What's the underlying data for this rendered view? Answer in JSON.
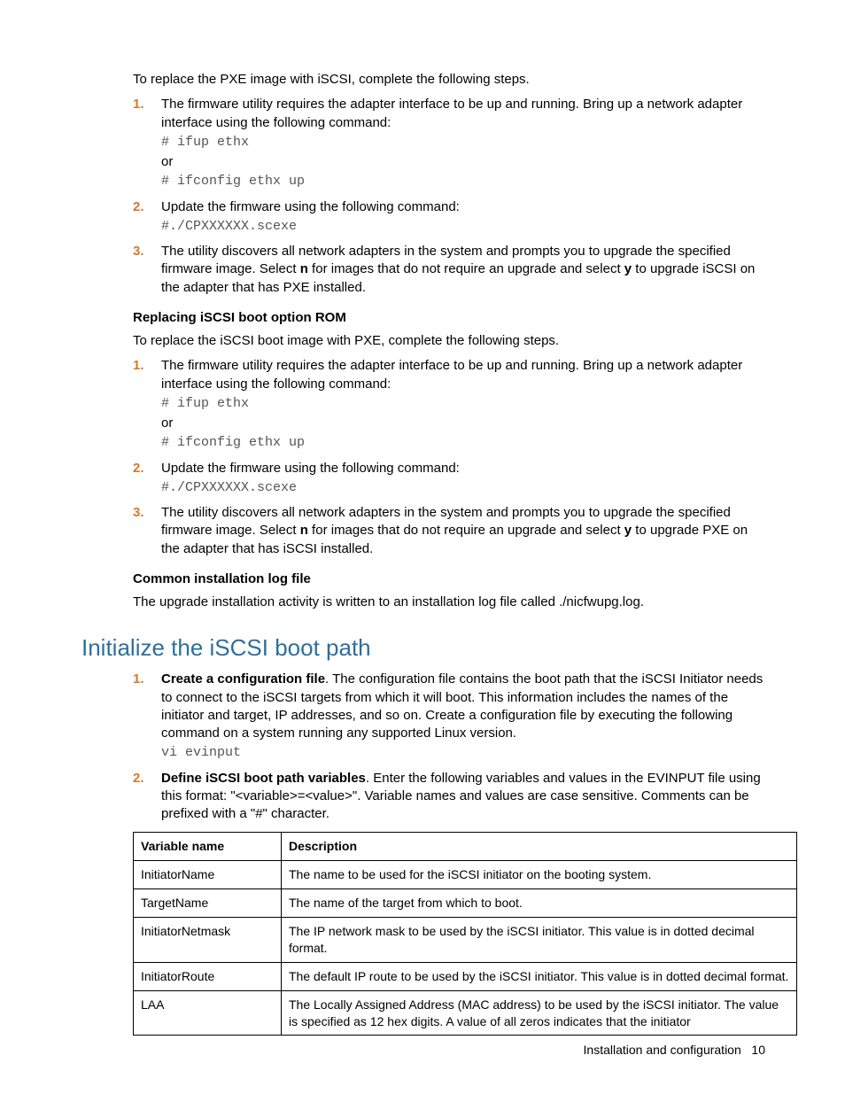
{
  "intro1": "To replace the PXE image with iSCSI, complete the following steps.",
  "stepsA": [
    {
      "num": "1.",
      "text": "The firmware utility requires the adapter interface to be up and running. Bring up a network adapter interface using the following command:",
      "code1": "# ifup ethx",
      "or": "or",
      "code2": "# ifconfig ethx up"
    },
    {
      "num": "2.",
      "text": "Update the firmware using the following command:",
      "code1": "#./CPXXXXXX.scexe"
    },
    {
      "num": "3.",
      "pre": "The utility discovers all network adapters in the system and prompts you to upgrade the specified firmware image. Select ",
      "bold1": "n",
      "mid": " for images that do not require an upgrade and select ",
      "bold2": "y",
      "post": " to upgrade iSCSI on the adapter that has PXE installed."
    }
  ],
  "headingA": "Replacing iSCSI boot option ROM",
  "intro2": "To replace the iSCSI boot image with PXE, complete the following steps.",
  "stepsB": [
    {
      "num": "1.",
      "text": "The firmware utility requires the adapter interface to be up and running. Bring up a network adapter interface using the following command:",
      "code1": "# ifup ethx",
      "or": "or",
      "code2": "# ifconfig ethx up"
    },
    {
      "num": "2.",
      "text": "Update the firmware using the following command:",
      "code1": "#./CPXXXXXX.scexe"
    },
    {
      "num": "3.",
      "pre": "The utility discovers all network adapters in the system and prompts you to upgrade the specified firmware image. Select ",
      "bold1": "n",
      "mid": " for images that do not require an upgrade and select ",
      "bold2": "y",
      "post": " to upgrade PXE on the adapter that has iSCSI installed."
    }
  ],
  "headingB": "Common installation log file",
  "intro3": "The upgrade installation activity is written to an installation log file called ./nicfwupg.log.",
  "sectionHeading": "Initialize the iSCSI boot path",
  "stepsC": [
    {
      "num": "1.",
      "bold": "Create a configuration file",
      "text": ". The configuration file contains the boot path that the iSCSI Initiator needs to connect to the iSCSI targets from which it will boot. This information includes the names of the initiator and target, IP addresses, and so on. Create a configuration file by executing the following command on a system running any supported Linux version.",
      "code1": "vi evinput"
    },
    {
      "num": "2.",
      "bold": "Define iSCSI boot path variables",
      "text": ". Enter the following variables and values in the EVINPUT file using this format: \"<variable>=<value>\".  Variable names and values are case sensitive. Comments can be prefixed with a \"#\" character."
    }
  ],
  "table": {
    "h1": "Variable name",
    "h2": "Description",
    "rows": [
      {
        "name": "InitiatorName",
        "desc": "The name to be used for the iSCSI initiator on the booting system."
      },
      {
        "name": "TargetName",
        "desc": "The name of the target from which to boot."
      },
      {
        "name": "InitiatorNetmask",
        "desc": "The IP network mask to be used by the iSCSI initiator. This value is in dotted decimal format."
      },
      {
        "name": "InitiatorRoute",
        "desc": "The default IP route to be used by the iSCSI initiator. This value is in dotted decimal format."
      },
      {
        "name": "LAA",
        "desc": "The Locally Assigned Address (MAC address) to be used by the iSCSI initiator. The value is specified as 12 hex digits. A value of all zeros indicates that the initiator"
      }
    ]
  },
  "footer": {
    "label": "Installation and configuration",
    "page": "10"
  }
}
